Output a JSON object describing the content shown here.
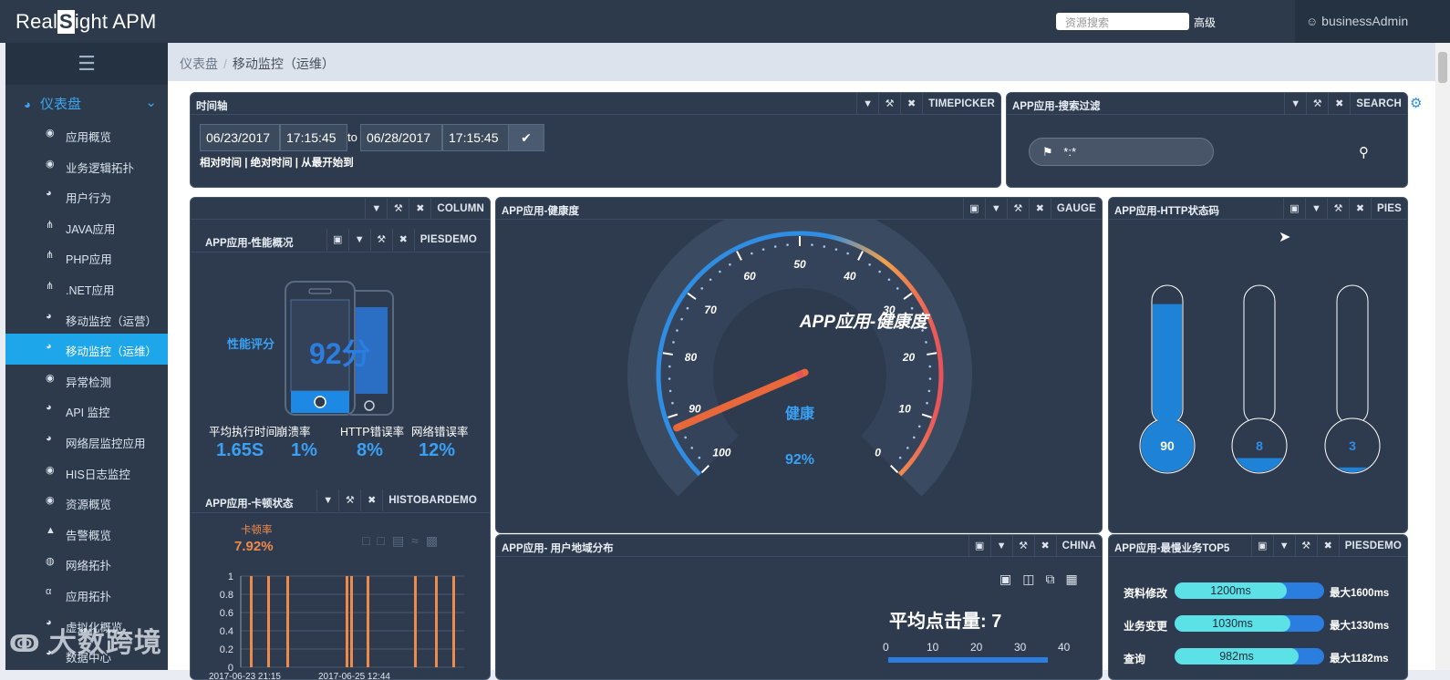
{
  "brand": {
    "logo_text_left": "Real",
    "logo_text_mid": "S",
    "logo_text_right": "ight APM"
  },
  "header": {
    "search_placeholder": "资源搜索",
    "advanced_label": "高级",
    "user_name": "businessAdmin"
  },
  "sidebar": {
    "dashboard_label": "仪表盘",
    "items": [
      {
        "icon": "globe-icon",
        "glyph": "◉",
        "label": "应用概览"
      },
      {
        "icon": "globe-icon",
        "glyph": "◉",
        "label": "业务逻辑拓扑"
      },
      {
        "icon": "dashboard-icon",
        "glyph": "◕",
        "label": "用户行为"
      },
      {
        "icon": "sitemap-icon",
        "glyph": "⋔",
        "label": "JAVA应用"
      },
      {
        "icon": "sitemap-icon",
        "glyph": "⋔",
        "label": "PHP应用"
      },
      {
        "icon": "sitemap-icon",
        "glyph": "⋔",
        "label": ".NET应用"
      },
      {
        "icon": "dashboard-icon",
        "glyph": "◕",
        "label": "移动监控（运营）"
      },
      {
        "icon": "dashboard-icon",
        "glyph": "◕",
        "label": "移动监控（运维）",
        "active": true
      },
      {
        "icon": "globe-icon",
        "glyph": "◉",
        "label": "异常检测"
      },
      {
        "icon": "dashboard-icon",
        "glyph": "◕",
        "label": "API 监控"
      },
      {
        "icon": "dashboard-icon",
        "glyph": "◕",
        "label": "网络层监控应用"
      },
      {
        "icon": "globe-icon",
        "glyph": "◉",
        "label": "HIS日志监控"
      },
      {
        "icon": "globe-icon",
        "glyph": "◉",
        "label": "资源概览"
      },
      {
        "icon": "warning-icon",
        "glyph": "▲",
        "label": "告警概览"
      },
      {
        "icon": "basketball-icon",
        "glyph": "◍",
        "label": "网络拓扑"
      },
      {
        "icon": "alpha-icon",
        "glyph": "α",
        "label": "应用拓扑"
      },
      {
        "icon": "dashboard-icon",
        "glyph": "◕",
        "label": "虚拟化概览"
      },
      {
        "icon": "dashboard-icon",
        "glyph": "◕",
        "label": "数据中心"
      }
    ]
  },
  "breadcrumb": {
    "root": "仪表盘",
    "current": "移动监控（运维）"
  },
  "timeline_panel": {
    "title": "时间轴",
    "type_label": "TIMEPICKER",
    "start_date": "06/23/2017",
    "start_time": "17:15:45",
    "to_label": "to",
    "end_date": "06/28/2017",
    "end_time": "17:15:45",
    "links": "相对时间 | 绝对时间 | 从最开始到"
  },
  "search_panel": {
    "title": "APP应用-搜索过滤",
    "type_label": "SEARCH",
    "query": "*:*"
  },
  "column_panel": {
    "type_label": "COLUMN"
  },
  "perf_panel": {
    "title": "APP应用-性能概况",
    "type_label": "PIESDEMO",
    "score_label": "性能评分",
    "score": "92分",
    "metrics": [
      {
        "label": "平均执行时间",
        "value": "1.65S"
      },
      {
        "label": "崩溃率",
        "value": "1%"
      },
      {
        "label": "HTTP错误率",
        "value": "8%"
      },
      {
        "label": "网络错误率",
        "value": "12%"
      }
    ]
  },
  "stutter_panel": {
    "title": "APP应用-卡顿状态",
    "type_label": "HISTOBARDEMO",
    "rate_label": "卡顿率",
    "rate_value": "7.92%",
    "chart_data": {
      "type": "bar",
      "values": [
        1,
        1,
        1,
        1,
        1,
        1,
        1,
        1,
        1
      ],
      "ylim": [
        0,
        1
      ],
      "yticks": [
        "1",
        "0.8",
        "0.6",
        "0.4",
        "0.2",
        "0"
      ],
      "xlabels": [
        "2017-06-23 21:15",
        "2017-06-25 12:44"
      ]
    }
  },
  "health_panel": {
    "title": "APP应用-健康度",
    "type_label": "GAUGE",
    "chart_data": {
      "type": "gauge",
      "title": "APP应用-健康度",
      "value": 92,
      "min": 100,
      "max": 0,
      "ticks": [
        "100",
        "90",
        "80",
        "70",
        "60",
        "50",
        "40",
        "30",
        "20",
        "10",
        "0"
      ],
      "status_label": "健康",
      "value_label": "92%"
    }
  },
  "http_panel": {
    "title": "APP应用-HTTP状态码",
    "type_label": "PIES",
    "chart_data": {
      "type": "bar",
      "values": [
        90,
        8,
        3
      ],
      "value_labels": [
        "90",
        "8",
        "3"
      ],
      "ylim": [
        0,
        100
      ]
    }
  },
  "geo_panel": {
    "title": "APP应用- 用户地域分布",
    "type_label": "CHINA",
    "avg_label": "平均点击量: 7",
    "axis_ticks": [
      "0",
      "10",
      "20",
      "30",
      "40"
    ]
  },
  "slow_panel": {
    "title": "APP应用-最慢业务TOP5",
    "type_label": "PIESDEMO",
    "chart_data": {
      "type": "bar",
      "categories": [
        "资料修改",
        "业务变更",
        "查询"
      ],
      "series": [
        {
          "values": [
            1200,
            1030,
            982
          ]
        },
        {
          "values": [
            1600,
            1330,
            1182
          ]
        }
      ],
      "value_labels": [
        "1200ms",
        "1030ms",
        "982ms"
      ],
      "max_labels": [
        "最大1600ms",
        "最大1330ms",
        "最大1182ms"
      ]
    }
  },
  "watermark": {
    "text": "大数跨境"
  },
  "colors": {
    "accent": "#1ea6ea",
    "panel": "#2e3b4e",
    "blue_value": "#3aa0f3",
    "orange": "#f08a4b"
  }
}
